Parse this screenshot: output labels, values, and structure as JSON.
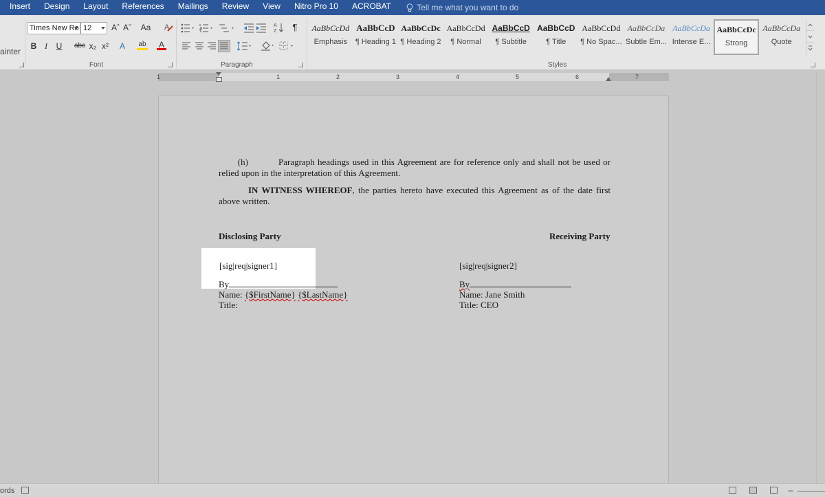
{
  "menu": {
    "tabs": [
      "Insert",
      "Design",
      "Layout",
      "References",
      "Mailings",
      "Review",
      "View",
      "Nitro Pro 10",
      "ACROBAT"
    ],
    "tell_me": "Tell me what you want to do"
  },
  "ribbon": {
    "clipboard_partial": "ainter",
    "font": {
      "name": "Times New Ro",
      "size": "12",
      "group_label": "Font",
      "grow_label": "Aˆ",
      "shrink_label": "Aˇ",
      "case_label": "Aa",
      "bold_label": "B",
      "italic_label": "I",
      "underline_label": "U",
      "strike_label": "abc",
      "subscript_label": "x₂",
      "superscript_label": "x²",
      "effects_label": "A",
      "highlight_label": "ab",
      "color_label": "A"
    },
    "paragraph": {
      "group_label": "Paragraph",
      "pilcrow": "¶"
    },
    "styles": {
      "group_label": "Styles",
      "items": [
        {
          "preview": "AaBbCcDd",
          "name": "Emphasis"
        },
        {
          "preview": "AaBbCcD",
          "name": "¶ Heading 1"
        },
        {
          "preview": "AaBbCcDc",
          "name": "¶ Heading 2"
        },
        {
          "preview": "AaBbCcDd",
          "name": "¶ Normal"
        },
        {
          "preview": "AaBbCcD",
          "name": "¶ Subtitle"
        },
        {
          "preview": "AaBbCcD",
          "name": "¶ Title"
        },
        {
          "preview": "AaBbCcDd",
          "name": "¶ No Spac..."
        },
        {
          "preview": "AaBbCcDa",
          "name": "Subtle Em..."
        },
        {
          "preview": "AaBbCcDa",
          "name": "Intense E..."
        },
        {
          "preview": "AaBbCcDc",
          "name": "Strong"
        },
        {
          "preview": "AaBbCcDa",
          "name": "Quote"
        }
      ]
    }
  },
  "ruler": {
    "numbers": [
      "1",
      "1",
      "2",
      "3",
      "4",
      "5",
      "6",
      "7"
    ]
  },
  "document": {
    "para_h_marker": "(h)",
    "para_h_text": "Paragraph headings used in this Agreement are for reference only and shall not be used or relied upon in the interpretation of this Agreement.",
    "witness_bold": "IN WITNESS WHEREOF",
    "witness_text": ", the parties hereto have executed this Agreement as of the date first above written.",
    "disclosing_party": "Disclosing Party",
    "receiving_party": "Receiving Party",
    "sig_tag_1": "[sig|req|signer1]",
    "sig_tag_2": "[sig|req|signer2]",
    "by_label": "By",
    "name1_prefix": "Name: ",
    "name1_first": "{$FirstName}",
    "name1_last": "{$LastName}",
    "name2": "Name: Jane Smith",
    "title1": "Title:",
    "title2": "Title: CEO"
  },
  "status": {
    "words_partial": "ords"
  },
  "colors": {
    "ribbon_tab_bar": "#2b579a",
    "highlight": "#ffffff"
  }
}
